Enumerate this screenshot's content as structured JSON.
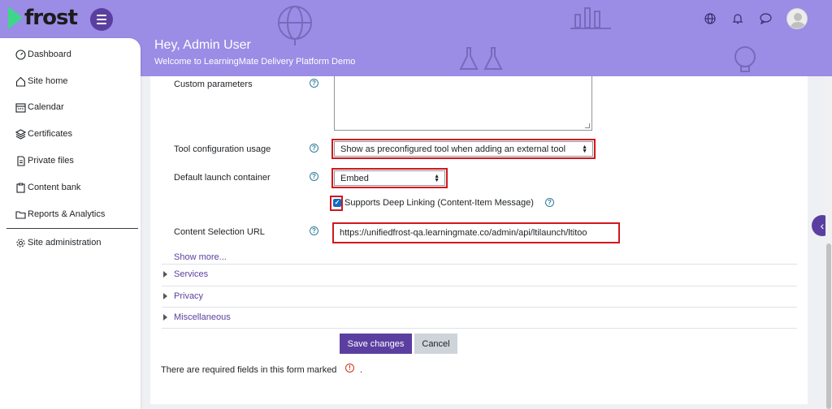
{
  "header": {
    "logo_text": "frost",
    "greeting": "Hey, Admin User",
    "welcome": "Welcome to LearningMate Delivery Platform Demo",
    "colors": {
      "accent": "#9b8ce6",
      "brand": "#5b3fa0",
      "logo_mark": "#3fd68b"
    }
  },
  "sidebar": {
    "items": [
      {
        "label": "Dashboard",
        "icon": "gauge-icon"
      },
      {
        "label": "Site home",
        "icon": "home-icon"
      },
      {
        "label": "Calendar",
        "icon": "calendar-icon"
      },
      {
        "label": "Certificates",
        "icon": "layers-icon"
      },
      {
        "label": "Private files",
        "icon": "file-icon"
      },
      {
        "label": "Content bank",
        "icon": "clipboard-icon"
      },
      {
        "label": "Reports & Analytics",
        "icon": "folder-icon"
      },
      {
        "label": "Site administration",
        "icon": "gear-icon"
      }
    ]
  },
  "form": {
    "custom_parameters_label": "Custom parameters",
    "tool_config_label": "Tool configuration usage",
    "tool_config_value": "Show as preconfigured tool when adding an external tool",
    "launch_container_label": "Default launch container",
    "launch_container_value": "Embed",
    "deep_linking_label": "Supports Deep Linking (Content-Item Message)",
    "content_url_label": "Content Selection URL",
    "content_url_value": "https://unifiedfrost-qa.learningmate.co/admin/api/ltilaunch/ltitoo",
    "show_more": "Show more...",
    "sections": [
      "Services",
      "Privacy",
      "Miscellaneous"
    ],
    "save_label": "Save changes",
    "cancel_label": "Cancel",
    "required_text": "There are required fields in this form marked",
    "required_dot": ".",
    "colors": {
      "highlight": "#d0181e",
      "link": "#5b3fa0",
      "checkbox": "#0f6cbf"
    }
  }
}
